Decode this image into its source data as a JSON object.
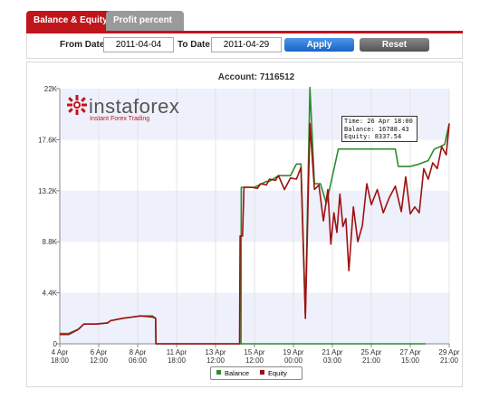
{
  "tabs": [
    "Balance & Equity",
    "Profit percent"
  ],
  "filter": {
    "from_label": "From Date",
    "from_value": "2011-04-04",
    "to_label": "To Date",
    "to_value": "2011-04-29",
    "apply_label": "Apply",
    "reset_label": "Reset"
  },
  "logo": {
    "name": "instaforex",
    "tagline": "Instant Forex Trading"
  },
  "tooltip": {
    "time": "Time: 26 Apr 18:00",
    "balance": "Balance: 16788.43",
    "equity": "Equity: 8337.54"
  },
  "colors": {
    "balance": "#2e8b2e",
    "equity": "#a01010",
    "accent": "#c0151b",
    "band": "#eef0fb"
  },
  "chart_data": {
    "type": "line",
    "title": "Account: 7116512",
    "xlabel": "",
    "ylabel": "",
    "ylim": [
      0,
      22000
    ],
    "yticks": [
      "0",
      "4.4K",
      "8.8K",
      "13.2K",
      "17.6K",
      "22K"
    ],
    "xticks": [
      "4 Apr\n18:00",
      "6 Apr\n12:00",
      "8 Apr\n06:00",
      "11 Apr\n18:00",
      "13 Apr\n12:00",
      "15 Apr\n12:00",
      "19 Apr\n00:00",
      "21 Apr\n03:00",
      "25 Apr\n21:00",
      "27 Apr\n15:00",
      "29 Apr\n21:00"
    ],
    "xrange": [
      0,
      13
    ],
    "grid": true,
    "legend": "bottom-center",
    "series": [
      {
        "name": "Balance",
        "x": [
          0.0,
          0.3,
          0.65,
          0.8,
          1.2,
          1.6,
          1.7,
          2.1,
          2.4,
          2.7,
          3.1,
          3.2,
          3.21,
          12.2,
          6.05,
          6.06,
          6.1,
          6.4,
          6.5,
          6.9,
          7.0,
          7.3,
          7.4,
          7.7,
          7.9,
          8.05,
          8.2,
          8.35,
          8.5,
          8.7,
          8.9,
          9.3,
          9.6,
          10.2,
          10.5,
          10.6,
          11.2,
          11.3,
          11.7,
          12.0,
          12.3,
          12.5,
          12.7,
          12.85,
          13.0
        ],
        "values": [
          900,
          900,
          1300,
          1700,
          1700,
          1800,
          2000,
          2200,
          2300,
          2400,
          2400,
          2200,
          0,
          0,
          0,
          13500,
          13500,
          13500,
          13500,
          14000,
          14000,
          14500,
          14500,
          14500,
          15500,
          15500,
          2600,
          22100,
          13800,
          13800,
          12100,
          16800,
          16800,
          16800,
          16800,
          16800,
          16800,
          15300,
          15300,
          15500,
          15800,
          16800,
          17000,
          17200,
          19000
        ]
      },
      {
        "name": "Equity",
        "x": [
          0.0,
          0.3,
          0.6,
          0.8,
          1.2,
          1.6,
          1.7,
          2.1,
          2.4,
          2.7,
          3.1,
          3.2,
          3.21,
          6.0,
          6.02,
          6.1,
          6.15,
          6.4,
          6.6,
          6.7,
          6.9,
          7.0,
          7.2,
          7.3,
          7.5,
          7.7,
          7.9,
          8.05,
          8.2,
          8.35,
          8.5,
          8.65,
          8.8,
          8.95,
          9.05,
          9.15,
          9.25,
          9.35,
          9.45,
          9.55,
          9.65,
          9.8,
          9.95,
          10.1,
          10.25,
          10.4,
          10.6,
          10.8,
          11.0,
          11.2,
          11.4,
          11.55,
          11.7,
          11.85,
          12.0,
          12.15,
          12.3,
          12.45,
          12.6,
          12.75,
          12.9,
          13.0
        ],
        "values": [
          800,
          800,
          1200,
          1700,
          1700,
          1800,
          2000,
          2200,
          2300,
          2400,
          2300,
          2200,
          0,
          0,
          9300,
          9300,
          13500,
          13500,
          13400,
          13800,
          13700,
          14200,
          14100,
          14500,
          13300,
          14300,
          14200,
          15200,
          2200,
          19000,
          13300,
          13700,
          10600,
          13300,
          8600,
          11300,
          9600,
          12900,
          10100,
          10800,
          6300,
          11800,
          8800,
          10200,
          13800,
          12000,
          13300,
          11300,
          12600,
          13600,
          11400,
          14400,
          11200,
          11800,
          11300,
          15100,
          14200,
          15600,
          15100,
          17000,
          16300,
          19000
        ]
      }
    ]
  }
}
